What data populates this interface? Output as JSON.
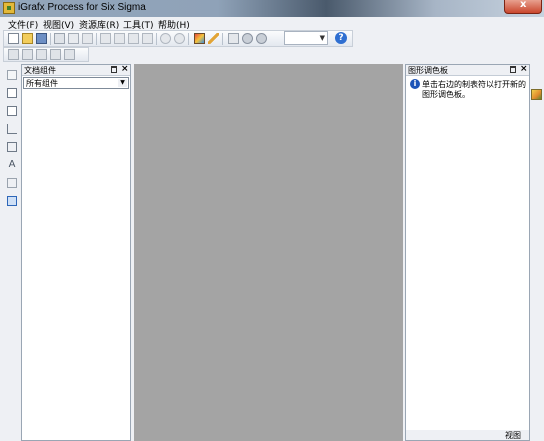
{
  "window": {
    "title": "iGrafx Process for Six Sigma"
  },
  "menu": {
    "items": [
      {
        "label": "文件(F)"
      },
      {
        "label": "视图(V)"
      },
      {
        "label": "资源库(R)"
      },
      {
        "label": "工具(T)"
      },
      {
        "label": "帮助(H)"
      }
    ]
  },
  "toolbar": {
    "zoom_value": "",
    "icons": [
      "new-icon",
      "open-icon",
      "save-icon",
      "print-icon",
      "print-preview-icon",
      "spell-check-icon",
      "cut-icon",
      "copy-icon",
      "paste-icon",
      "format-painter-icon",
      "undo-icon",
      "redo-icon",
      "color-palette-icon",
      "pencil-icon",
      "diagram-icon",
      "back-icon",
      "forward-icon",
      "help-icon"
    ]
  },
  "documents_panel": {
    "title": "文档组件",
    "filter_selected": "所有组件"
  },
  "palette_panel": {
    "title": "图形调色板",
    "message_line1": "单击右边的制表符以打开新的",
    "message_line2": "图形调色板。",
    "footer_label": "视图"
  },
  "colors": {
    "canvas": "#a4a4a4",
    "panel_bg": "#ffffff",
    "chrome": "#eef0f4",
    "info_blue": "#1d54b8"
  }
}
